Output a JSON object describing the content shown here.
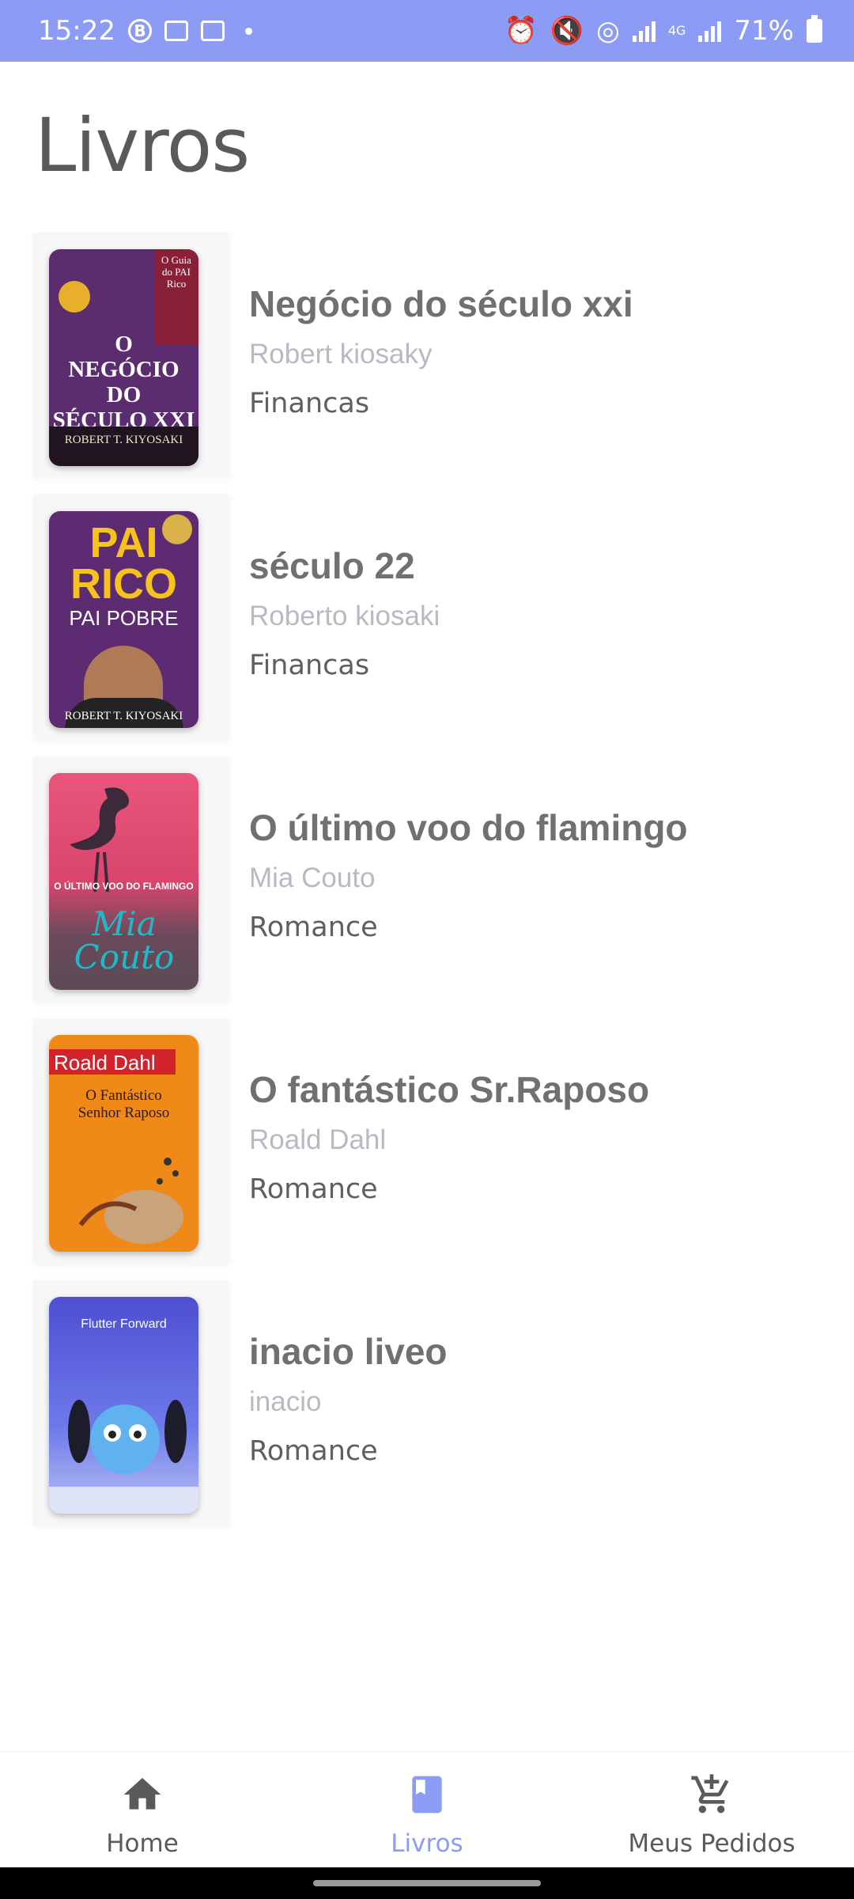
{
  "status_bar": {
    "time": "15:22",
    "battery": "71%",
    "network": "4G",
    "left_icons": [
      "b-circle-icon",
      "image-icon",
      "sim-icon",
      "dot-icon"
    ],
    "right_icons": [
      "alarm-icon",
      "mute-icon",
      "hotspot-icon",
      "signal-icon",
      "signal-icon",
      "battery-icon"
    ]
  },
  "page": {
    "title": "Livros"
  },
  "books": [
    {
      "title": "Negócio do século xxi",
      "author": "Robert kiosaky",
      "genre": "Financas",
      "cover": {
        "lines": [
          "O",
          "NEGÓCIO",
          "DO",
          "SÉCULO XXI"
        ],
        "top": "O Guia do PAI Rico",
        "bottom": "ROBERT T. KIYOSAKI"
      }
    },
    {
      "title": "século 22",
      "author": "Roberto kiosaki",
      "genre": "Financas",
      "cover": {
        "lines": [
          "PAI",
          "RICO",
          "PAI POBRE"
        ],
        "bottom": "ROBERT T. KIYOSAKI"
      }
    },
    {
      "title": "O último voo do flamingo",
      "author": "Mia Couto",
      "genre": "Romance",
      "cover": {
        "lines": [
          "O ÚLTIMO VOO DO FLAMINGO"
        ],
        "bottom": "Mia Couto"
      }
    },
    {
      "title": "O fantástico Sr.Raposo",
      "author": "Roald Dahl",
      "genre": "Romance",
      "cover": {
        "lines": [
          "Roald Dahl",
          "O Fantástico",
          "Senhor Raposo"
        ]
      }
    },
    {
      "title": "inacio liveo",
      "author": "inacio",
      "genre": "Romance",
      "cover": {
        "lines": [
          "Flutter Forward"
        ]
      }
    }
  ],
  "nav": {
    "items": [
      {
        "label": "Home",
        "icon": "home-icon",
        "active": false
      },
      {
        "label": "Livros",
        "icon": "book-icon",
        "active": true
      },
      {
        "label": "Meus Pedidos",
        "icon": "cart-add-icon",
        "active": false
      }
    ]
  },
  "colors": {
    "accent": "#8c9cf5",
    "title_text": "#707070",
    "author_text": "#b9b9c4",
    "genre_text": "#5f5f5f"
  }
}
